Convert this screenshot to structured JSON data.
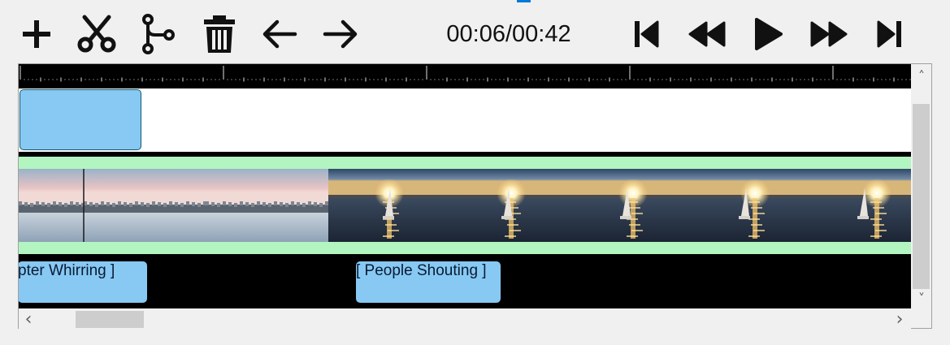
{
  "toolbar": {
    "items": [
      {
        "name": "add",
        "icon": "plus-icon"
      },
      {
        "name": "cut",
        "icon": "scissors-icon"
      },
      {
        "name": "split",
        "icon": "branch-icon"
      },
      {
        "name": "delete",
        "icon": "trash-icon"
      },
      {
        "name": "undo",
        "icon": "arrow-left-icon"
      },
      {
        "name": "redo",
        "icon": "arrow-right-icon"
      }
    ],
    "playback": [
      {
        "name": "go-to-start",
        "icon": "skip-back-icon"
      },
      {
        "name": "rewind",
        "icon": "rewind-icon"
      },
      {
        "name": "play",
        "icon": "play-icon"
      },
      {
        "name": "fast-forward",
        "icon": "fast-forward-icon"
      },
      {
        "name": "go-to-end",
        "icon": "skip-forward-icon"
      }
    ]
  },
  "player": {
    "timecode": "00:06/00:42"
  },
  "timeline": {
    "subtitles": [
      {
        "text": "pter Whirring ]"
      },
      {
        "text": "[ People Shouting ]"
      }
    ]
  },
  "scrollbars": {
    "up_arrow": "˄",
    "down_arrow": "˅",
    "left_arrow": "‹",
    "right_arrow": "›"
  },
  "colors": {
    "clip_blue": "#87c9f3",
    "band_green": "#b2f5c0",
    "accent_blue": "#0078d7"
  }
}
